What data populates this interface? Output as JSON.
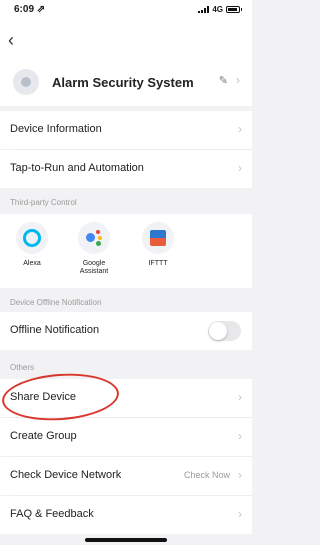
{
  "status_bar": {
    "time": "6:09 ⇗",
    "signal_label": "4G"
  },
  "device": {
    "name": "Alarm Security System"
  },
  "rows_top": [
    {
      "label": "Device Information"
    },
    {
      "label": "Tap-to-Run and Automation"
    }
  ],
  "third_party": {
    "section_label": "Third-party Control",
    "items": [
      {
        "label": "Alexa"
      },
      {
        "label": "Google\nAssistant"
      },
      {
        "label": "IFTTT"
      }
    ]
  },
  "offline": {
    "section_label": "Device Offline Notification",
    "row_label": "Offline Notification",
    "enabled": false
  },
  "others": {
    "section_label": "Others",
    "rows": [
      {
        "label": "Share Device"
      },
      {
        "label": "Create Group"
      },
      {
        "label": "Check Device Network",
        "value": "Check Now"
      },
      {
        "label": "FAQ & Feedback"
      }
    ]
  },
  "colors": {
    "accent_red": "#d9372c",
    "alexa_blue": "#00b7f0"
  }
}
